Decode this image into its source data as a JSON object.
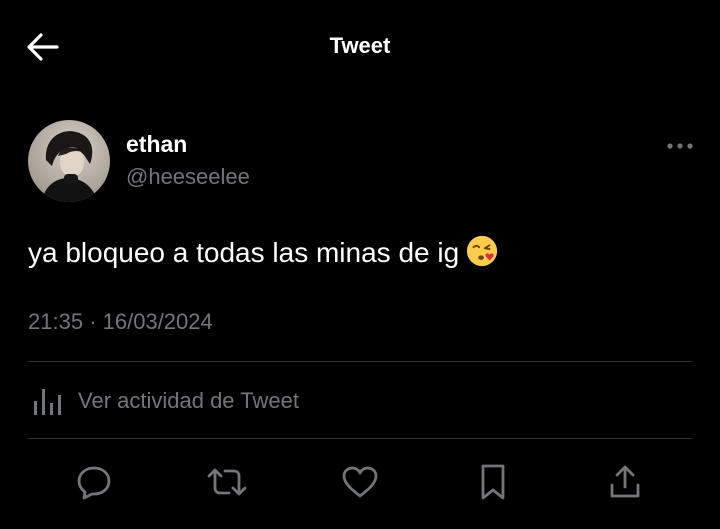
{
  "header": {
    "title": "Tweet",
    "back_icon": "arrow-left-icon"
  },
  "author": {
    "name": "ethan",
    "handle": "@heeseelee",
    "avatar": "profile-photo"
  },
  "tweet": {
    "text": "ya bloqueo a todas las minas de ig",
    "emoji": "face-blowing-a-kiss-emoji",
    "time": "21:35",
    "separator": "·",
    "date": "16/03/2024"
  },
  "analytics": {
    "label": "Ver actividad de Tweet",
    "icon": "analytics-bars-icon"
  },
  "actions": [
    {
      "name": "reply",
      "icon": "reply-icon"
    },
    {
      "name": "retweet",
      "icon": "retweet-icon"
    },
    {
      "name": "like",
      "icon": "heart-icon"
    },
    {
      "name": "bookmark",
      "icon": "bookmark-icon"
    },
    {
      "name": "share",
      "icon": "share-icon"
    }
  ],
  "colors": {
    "background": "#000000",
    "primary_text": "#ffffff",
    "secondary_text": "#71767b",
    "divider": "#2f3336"
  }
}
